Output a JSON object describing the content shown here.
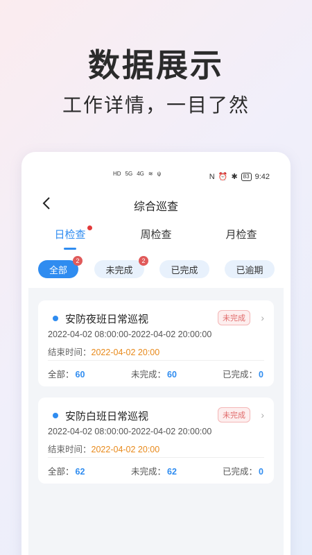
{
  "promo": {
    "title": "数据展示",
    "subtitle": "工作详情，一目了然"
  },
  "status_bar": {
    "left_indicators": [
      "HD",
      "5G",
      "4G"
    ],
    "battery": "83",
    "time": "9:42"
  },
  "header": {
    "title": "综合巡查"
  },
  "tabs": [
    {
      "label": "日检查",
      "active": true,
      "has_dot": true
    },
    {
      "label": "周检查",
      "active": false,
      "has_dot": false
    },
    {
      "label": "月检查",
      "active": false,
      "has_dot": false
    }
  ],
  "filters": [
    {
      "label": "全部",
      "active": true,
      "badge": "2"
    },
    {
      "label": "未完成",
      "active": false,
      "badge": "2"
    },
    {
      "label": "已完成",
      "active": false,
      "badge": ""
    },
    {
      "label": "已逾期",
      "active": false,
      "badge": ""
    }
  ],
  "tasks": [
    {
      "title": "安防夜班日常巡视",
      "status": "未完成",
      "time_range": "2022-04-02 08:00:00-2022-04-02 20:00:00",
      "end_label": "结束时间：",
      "end_value": "2022-04-02 20:00",
      "stats": [
        {
          "label": "全部：",
          "value": "60"
        },
        {
          "label": "未完成：",
          "value": "60"
        },
        {
          "label": "已完成：",
          "value": "0"
        }
      ]
    },
    {
      "title": "安防白班日常巡视",
      "status": "未完成",
      "time_range": "2022-04-02 08:00:00-2022-04-02 20:00:00",
      "end_label": "结束时间：",
      "end_value": "2022-04-02 20:00",
      "stats": [
        {
          "label": "全部：",
          "value": "62"
        },
        {
          "label": "未完成：",
          "value": "62"
        },
        {
          "label": "已完成：",
          "value": "0"
        }
      ]
    }
  ],
  "colors": {
    "accent": "#2f8cf0",
    "warning": "#e8891a",
    "danger": "#e05a5a"
  }
}
